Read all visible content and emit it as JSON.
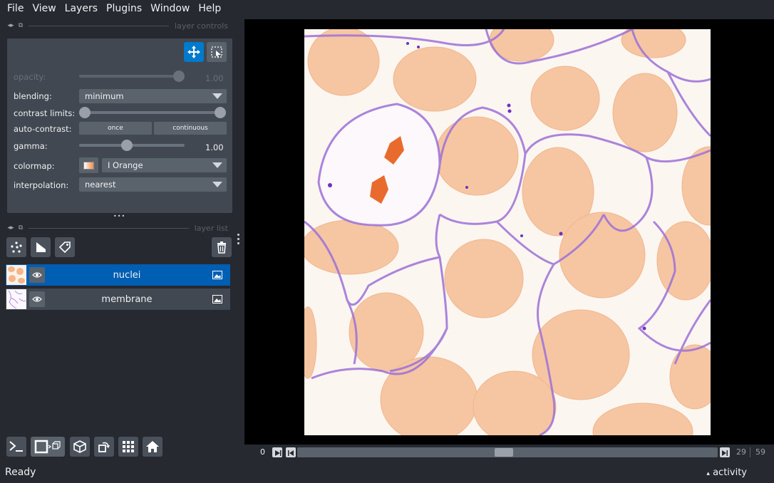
{
  "menu": [
    "File",
    "View",
    "Layers",
    "Plugins",
    "Window",
    "Help"
  ],
  "layer_controls": {
    "title": "layer controls",
    "opacity_label": "opacity:",
    "opacity_value": "1.00",
    "blending_label": "blending:",
    "blending_value": "minimum",
    "contrast_label": "contrast limits:",
    "autocontrast_label": "auto-contrast:",
    "once_label": "once",
    "continuous_label": "continuous",
    "gamma_label": "gamma:",
    "gamma_value": "1.00",
    "colormap_label": "colormap:",
    "colormap_value": "I Orange",
    "interpolation_label": "interpolation:",
    "interpolation_value": "nearest",
    "more_dots": "•••"
  },
  "layer_list": {
    "title": "layer list",
    "layers": [
      {
        "name": "nuclei",
        "selected": true
      },
      {
        "name": "membrane",
        "selected": false
      }
    ]
  },
  "dims": {
    "start": "0",
    "current": "29",
    "max": "59"
  },
  "status": {
    "text": "Ready",
    "activity": "activity",
    "activity_arrow": "▴"
  },
  "colors": {
    "background": "#262930",
    "panel": "#414851",
    "accent": "#007acc",
    "selected_layer": "#005eb3",
    "nuclei": "#f28c4a",
    "membrane": "#8a4fd6"
  }
}
